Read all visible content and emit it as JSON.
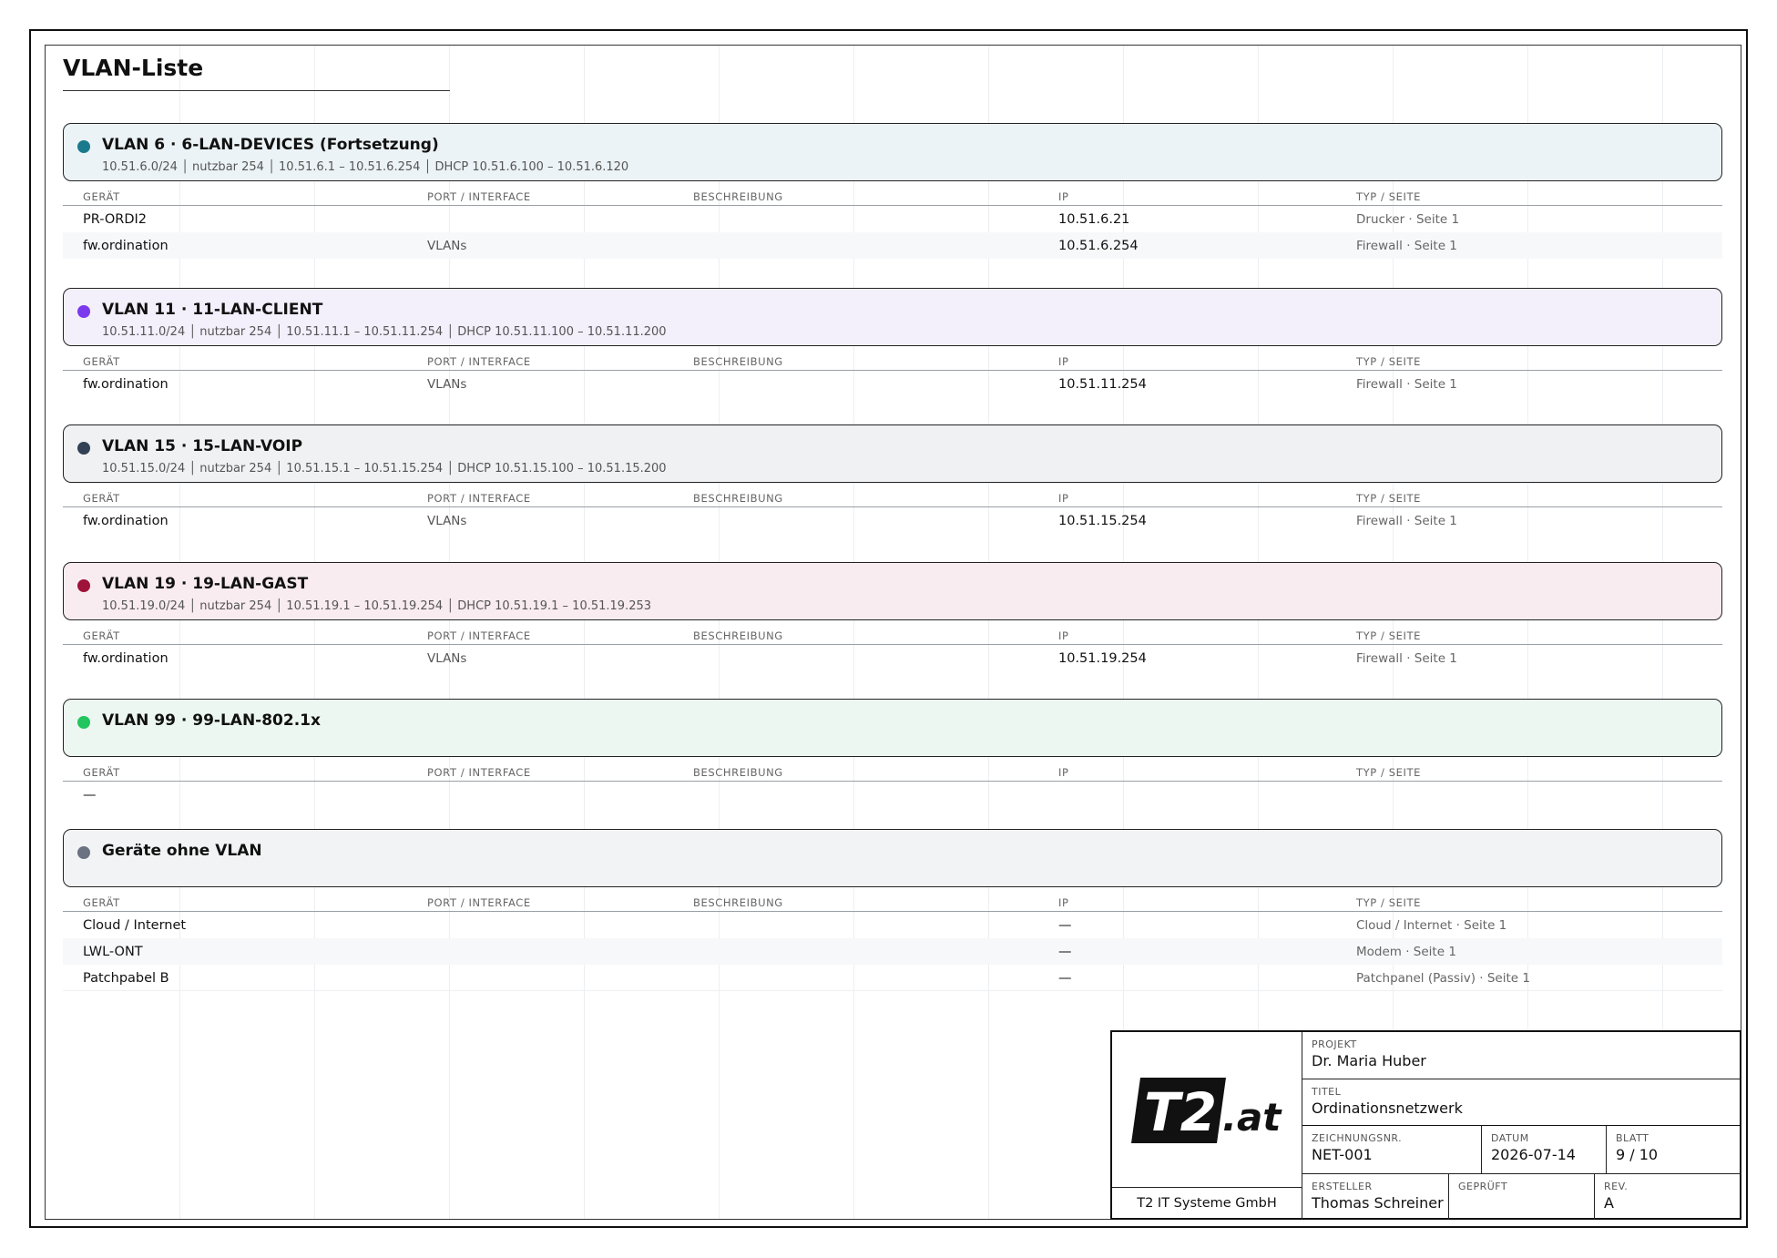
{
  "page_title": "VLAN-Liste",
  "columns": [
    "GERÄT",
    "PORT / INTERFACE",
    "BESCHREIBUNG",
    "IP",
    "TYP / SEITE"
  ],
  "sections": [
    {
      "title": "VLAN 6 · 6-LAN-DEVICES (Fortsetzung)",
      "subtitle": "10.51.6.0/24 │ nutzbar 254 │ 10.51.6.1 – 10.51.6.254 │ DHCP 10.51.6.100 – 10.51.6.120",
      "color": "#1a7a8c",
      "bg": "#ecf3f6",
      "rows": [
        {
          "device": "PR-ORDI2",
          "port": "",
          "desc": "",
          "ip": "10.51.6.21",
          "type": "Drucker · Seite 1"
        },
        {
          "device": "fw.ordination",
          "port": "VLANs",
          "desc": "",
          "ip": "10.51.6.254",
          "type": "Firewall · Seite 1"
        }
      ]
    },
    {
      "title": "VLAN 11 · 11-LAN-CLIENT",
      "subtitle": "10.51.11.0/24 │ nutzbar 254 │ 10.51.11.1 – 10.51.11.254 │ DHCP 10.51.11.100 – 10.51.11.200",
      "color": "#7c3aed",
      "bg": "#f3effb",
      "rows": [
        {
          "device": "fw.ordination",
          "port": "VLANs",
          "desc": "",
          "ip": "10.51.11.254",
          "type": "Firewall · Seite 1"
        }
      ]
    },
    {
      "title": "VLAN 15 · 15-LAN-VOIP",
      "subtitle": "10.51.15.0/24 │ nutzbar 254 │ 10.51.15.1 – 10.51.15.254 │ DHCP 10.51.15.100 – 10.51.15.200",
      "color": "#334155",
      "bg": "#eff1f3",
      "rows": [
        {
          "device": "fw.ordination",
          "port": "VLANs",
          "desc": "",
          "ip": "10.51.15.254",
          "type": "Firewall · Seite 1"
        }
      ]
    },
    {
      "title": "VLAN 19 · 19-LAN-GAST",
      "subtitle": "10.51.19.0/24 │ nutzbar 254 │ 10.51.19.1 – 10.51.19.254 │ DHCP 10.51.19.1 – 10.51.19.253",
      "color": "#9f1239",
      "bg": "#f8ecf1",
      "rows": [
        {
          "device": "fw.ordination",
          "port": "VLANs",
          "desc": "",
          "ip": "10.51.19.254",
          "type": "Firewall · Seite 1"
        }
      ]
    },
    {
      "title": "VLAN 99 · 99-LAN-802.1x",
      "subtitle": "",
      "color": "#22c55e",
      "bg": "#edf7f1",
      "empty_marker": "—",
      "rows": []
    },
    {
      "title": "Geräte ohne VLAN",
      "subtitle": "",
      "color": "#6b7280",
      "bg": "#f2f3f4",
      "rows": [
        {
          "device": "Cloud / Internet",
          "port": "",
          "desc": "",
          "ip": "—",
          "type": "Cloud / Internet · Seite 1"
        },
        {
          "device": "LWL-ONT",
          "port": "",
          "desc": "",
          "ip": "—",
          "type": "Modem · Seite 1"
        },
        {
          "device": "Patchpabel B",
          "port": "",
          "desc": "",
          "ip": "—",
          "type": "Patchpanel (Passiv) · Seite 1"
        }
      ]
    }
  ],
  "title_block": {
    "logo_main": "T2",
    "logo_suffix": ".at",
    "company": "T2 IT Systeme GmbH",
    "projekt_label": "PROJEKT",
    "projekt": "Dr. Maria Huber",
    "titel_label": "TITEL",
    "titel": "Ordinationsnetzwerk",
    "zeichnungsnr_label": "ZEICHNUNGSNR.",
    "zeichnungsnr": "NET-001",
    "datum_label": "DATUM",
    "datum": "2026-07-14",
    "blatt_label": "BLATT",
    "blatt": "9 / 10",
    "ersteller_label": "ERSTELLER",
    "ersteller": "Thomas Schreiner",
    "geprueft_label": "GEPRÜFT",
    "geprueft": "",
    "rev_label": "REV.",
    "rev": "A"
  }
}
